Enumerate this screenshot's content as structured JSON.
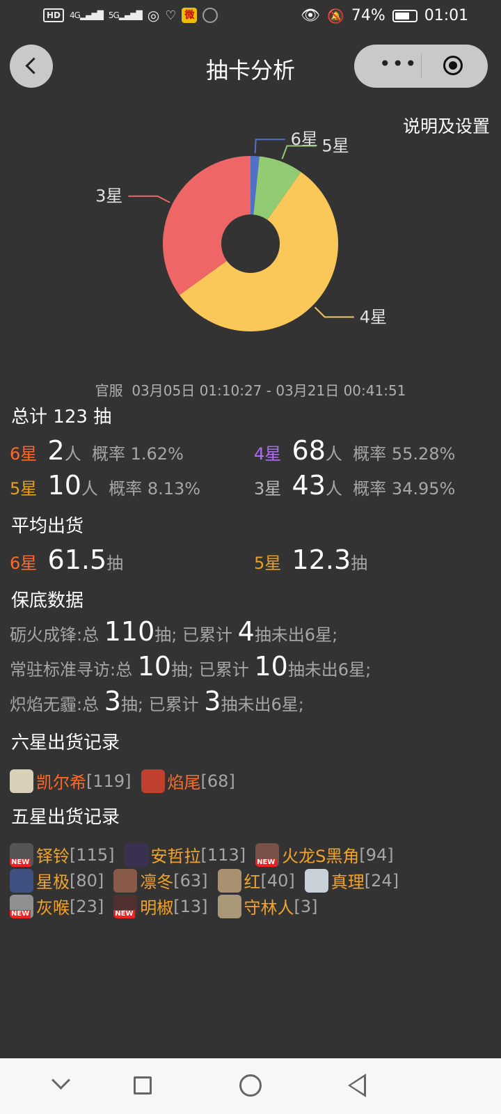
{
  "statusbar": {
    "hd": "HD",
    "sig1": "4G",
    "sig2": "5G",
    "battery_pct": "74%",
    "time": "01:01",
    "battery_level": 0.74
  },
  "header": {
    "title": "抽卡分析",
    "settings": "说明及设置"
  },
  "chart_data": {
    "type": "pie",
    "donut": true,
    "slices": [
      {
        "label": "6星",
        "value": 2,
        "color": "#5470c6"
      },
      {
        "label": "5星",
        "value": 10,
        "color": "#91cc75"
      },
      {
        "label": "4星",
        "value": 68,
        "color": "#fac858"
      },
      {
        "label": "3星",
        "value": 43,
        "color": "#ee6666"
      }
    ]
  },
  "info": {
    "server": "官服",
    "range": "03月05日 01:10:27 - 03月21日 00:41:51",
    "total_prefix": "总计",
    "total": "123",
    "total_suffix": "抽",
    "stars": [
      {
        "label": "6星",
        "count": "2",
        "unit": "人",
        "rate_label": "概率",
        "rate": "1.62%"
      },
      {
        "label": "4星",
        "count": "68",
        "unit": "人",
        "rate_label": "概率",
        "rate": "55.28%"
      },
      {
        "label": "5星",
        "count": "10",
        "unit": "人",
        "rate_label": "概率",
        "rate": "8.13%"
      },
      {
        "label": "3星",
        "count": "43",
        "unit": "人",
        "rate_label": "概率",
        "rate": "34.95%"
      }
    ]
  },
  "average": {
    "title": "平均出货",
    "six_label": "6星",
    "six_value": "61.5",
    "six_unit": "抽",
    "five_label": "5星",
    "five_value": "12.3",
    "five_unit": "抽"
  },
  "pity": {
    "title": "保底数据",
    "rows": [
      {
        "name": "砺火成锋:总",
        "total": "110",
        "mid": "抽; 已累计",
        "acc": "4",
        "tail": "抽未出6星;"
      },
      {
        "name": "常驻标准寻访:总",
        "total": "10",
        "mid": "抽; 已累计",
        "acc": "10",
        "tail": "抽未出6星;"
      },
      {
        "name": "炽焰无霾:总",
        "total": "3",
        "mid": "抽; 已累计",
        "acc": "3",
        "tail": "抽未出6星;"
      }
    ]
  },
  "six_records": {
    "title": "六星出货记录",
    "items": [
      {
        "name": "凯尔希",
        "count": "[119]",
        "avatar_color": "#d8d0b8"
      },
      {
        "name": "焰尾",
        "count": "[68]",
        "avatar_color": "#c04030"
      }
    ]
  },
  "five_records": {
    "title": "五星出货记录",
    "new_tag": "NEW",
    "items": [
      {
        "name": "铎铃",
        "count": "[115]",
        "new": true,
        "avatar_color": "#555555"
      },
      {
        "name": "安哲拉",
        "count": "[113]",
        "new": false,
        "avatar_color": "#3a3050"
      },
      {
        "name": "火龙S黑角",
        "count": "[94]",
        "new": true,
        "avatar_color": "#7a5048"
      },
      {
        "name": "星极",
        "count": "[80]",
        "new": false,
        "avatar_color": "#405080"
      },
      {
        "name": "凛冬",
        "count": "[63]",
        "new": false,
        "avatar_color": "#8a5a48"
      },
      {
        "name": "红",
        "count": "[40]",
        "new": false,
        "avatar_color": "#a89070"
      },
      {
        "name": "真理",
        "count": "[24]",
        "new": false,
        "avatar_color": "#c8d0d8"
      },
      {
        "name": "灰喉",
        "count": "[23]",
        "new": true,
        "avatar_color": "#909090"
      },
      {
        "name": "明椒",
        "count": "[13]",
        "new": true,
        "avatar_color": "#503030"
      },
      {
        "name": "守林人",
        "count": "[3]",
        "new": false,
        "avatar_color": "#a89878"
      }
    ]
  }
}
